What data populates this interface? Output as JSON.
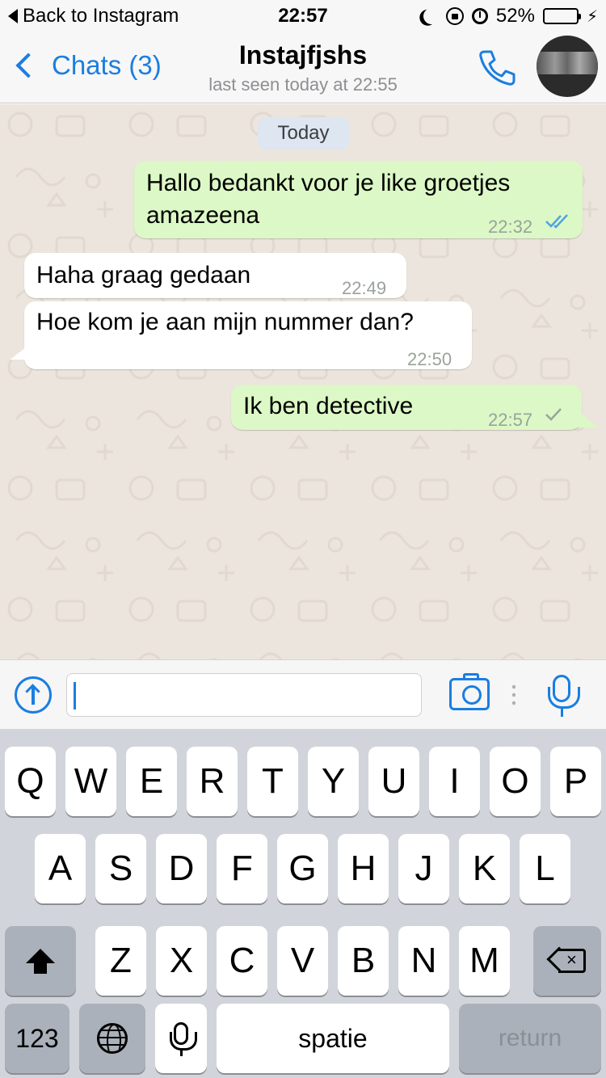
{
  "status_bar": {
    "back_label": "Back to Instagram",
    "time": "22:57",
    "battery_percent": "52%",
    "battery_level": 0.52
  },
  "nav": {
    "back_label": "Chats (3)",
    "contact_name": "Instajfjshs",
    "last_seen": "last seen today at 22:55"
  },
  "chat": {
    "date_badge": "Today",
    "messages": [
      {
        "direction": "outgoing",
        "text_lines": [
          "Hallo bedankt voor je like groetjes",
          "amazeena"
        ],
        "time": "22:32",
        "status": "read"
      },
      {
        "direction": "incoming",
        "text": "Haha graag gedaan",
        "time": "22:49"
      },
      {
        "direction": "incoming",
        "text": "Hoe kom je aan mijn nummer dan?",
        "time": "22:50"
      },
      {
        "direction": "outgoing",
        "text": "Ik ben detective",
        "time": "22:57",
        "status": "sent"
      }
    ]
  },
  "input": {
    "value": ""
  },
  "keyboard": {
    "row1": [
      "Q",
      "W",
      "E",
      "R",
      "T",
      "Y",
      "U",
      "I",
      "O",
      "P"
    ],
    "row2": [
      "A",
      "S",
      "D",
      "F",
      "G",
      "H",
      "J",
      "K",
      "L"
    ],
    "row3": [
      "Z",
      "X",
      "C",
      "V",
      "B",
      "N",
      "M"
    ],
    "numbers_label": "123",
    "space_label": "spatie",
    "return_label": "return"
  },
  "colors": {
    "accent": "#1a7ee0",
    "outgoing_bubble": "#dcf8c6",
    "incoming_bubble": "#ffffff",
    "chat_background": "#ece5dd",
    "read_ticks": "#4fa3e0",
    "sent_tick": "#9aa39a"
  }
}
